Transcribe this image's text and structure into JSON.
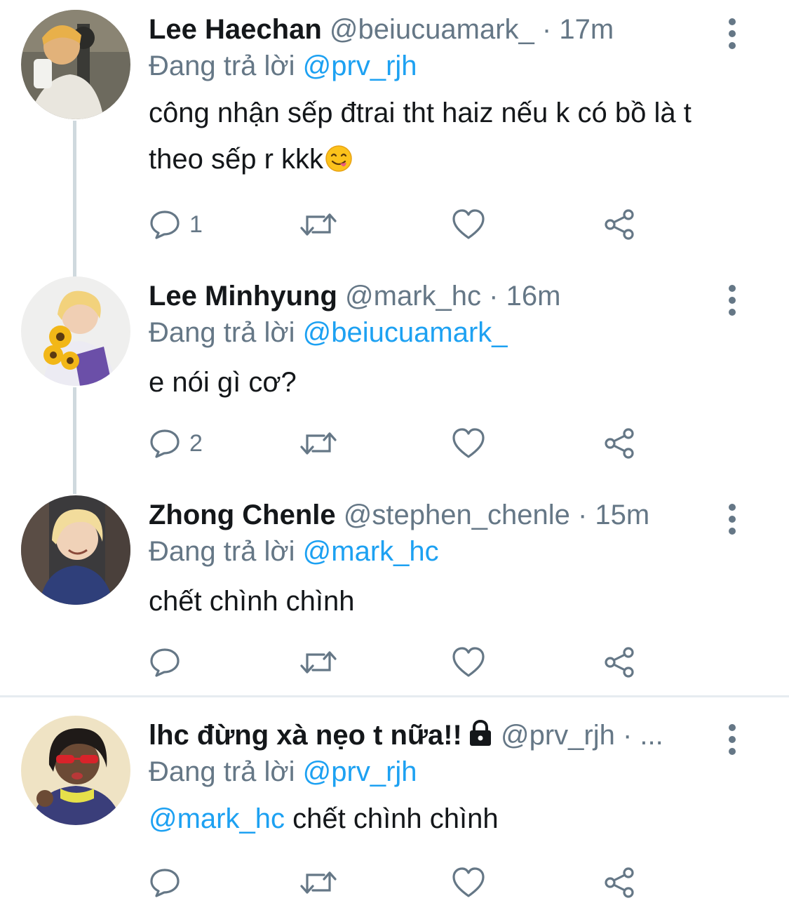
{
  "tweets": [
    {
      "name": "Lee Haechan",
      "handle": "@beiucuamark_",
      "separator": "·",
      "time": "17m",
      "reply_prefix": "Đang trả lời",
      "reply_to": "@prv_rjh",
      "text": "công nhận sếp đtrai tht haiz nếu k có bồ là t theo sếp r kkk",
      "emoji_icon": "savoring-food-face-icon",
      "reply_count": "1"
    },
    {
      "name": "Lee Minhyung",
      "handle": "@mark_hc",
      "separator": "·",
      "time": "16m",
      "reply_prefix": "Đang trả lời",
      "reply_to": "@beiucuamark_",
      "text": "e nói gì cơ?",
      "reply_count": "2"
    },
    {
      "name": "Zhong Chenle",
      "handle": "@stephen_chenle",
      "separator": "·",
      "time": "15m",
      "reply_prefix": "Đang trả lời",
      "reply_to": "@mark_hc",
      "text": "chết chình chình",
      "reply_count": ""
    },
    {
      "name": "lhc đừng xà nẹo t nữa!!",
      "handle": "@prv_rjh",
      "separator": "·",
      "time": "...",
      "reply_prefix": "Đang trả lời",
      "reply_to": "@prv_rjh",
      "mention": "@mark_hc",
      "text": " chết chình chình",
      "reply_count": ""
    }
  ],
  "icons": {
    "reply": "reply-icon",
    "retweet": "retweet-icon",
    "like": "heart-icon",
    "share": "share-icon",
    "more": "more-vertical-icon",
    "lock": "lock-icon"
  },
  "colors": {
    "text": "#14171a",
    "muted": "#657786",
    "link": "#1da1f2",
    "thread_line": "#cfd9de",
    "divider": "#e6ecf0"
  }
}
